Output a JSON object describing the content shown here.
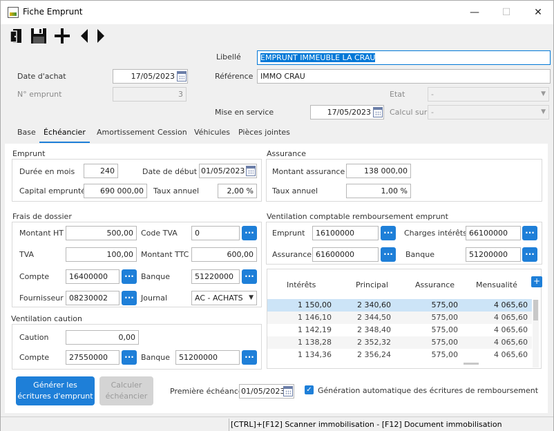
{
  "window": {
    "title": "Fiche Emprunt",
    "minimize": "—",
    "maximize": "☐",
    "close": "✕"
  },
  "toolbar": {
    "exit_icon": "exit-door-icon",
    "save_icon": "save-floppy-icon",
    "add_icon": "add-plus-icon",
    "prev_icon": "previous-arrow-icon",
    "next_icon": "next-arrow-icon"
  },
  "header": {
    "libelle_label": "Libellé",
    "libelle_value": "EMPRUNT IMMEUBLE LA CRAU",
    "date_achat_label": "Date d'achat",
    "date_achat_value": "17/05/2023",
    "reference_label": "Référence",
    "reference_value": "IMMO CRAU",
    "numero_label": "N° emprunt",
    "numero_value": "3",
    "etat_label": "Etat",
    "etat_value": "-",
    "mise_service_label": "Mise en service",
    "mise_service_value": "17/05/2023",
    "calcul_sur_label": "Calcul sur",
    "calcul_sur_value": "-"
  },
  "tabs": [
    "Base",
    "Échéancier",
    "Amortissement",
    "Cession",
    "Véhicules",
    "Pièces jointes"
  ],
  "emprunt": {
    "title": "Emprunt",
    "duree_label": "Durée en mois",
    "duree_value": "240",
    "date_debut_label": "Date de début",
    "date_debut_value": "01/05/2023",
    "capital_label": "Capital emprunté",
    "capital_value": "690 000,00",
    "taux_label": "Taux annuel",
    "taux_value": "2,00 %"
  },
  "assurance": {
    "title": "Assurance",
    "montant_label": "Montant assurance",
    "montant_value": "138 000,00",
    "taux_label": "Taux annuel",
    "taux_value": "1,00 %"
  },
  "frais": {
    "title": "Frais de dossier",
    "montant_ht_label": "Montant HT",
    "montant_ht_value": "500,00",
    "code_tva_label": "Code TVA",
    "code_tva_value": "0",
    "tva_label": "TVA",
    "tva_value": "100,00",
    "montant_ttc_label": "Montant TTC",
    "montant_ttc_value": "600,00",
    "compte_label": "Compte",
    "compte_value": "16400000",
    "banque_label": "Banque",
    "banque_value": "51220000",
    "fournisseur_label": "Fournisseur",
    "fournisseur_value": "08230002",
    "journal_label": "Journal",
    "journal_value": "AC - ACHATS"
  },
  "ventilation_remb": {
    "title": "Ventilation comptable remboursement emprunt",
    "emprunt_label": "Emprunt",
    "emprunt_value": "16100000",
    "charges_label": "Charges intérêts",
    "charges_value": "66100000",
    "assurance_label": "Assurance",
    "assurance_value": "61600000",
    "banque_label": "Banque",
    "banque_value": "51200000"
  },
  "caution": {
    "title": "Ventilation caution",
    "caution_label": "Caution",
    "caution_value": "0,00",
    "compte_label": "Compte",
    "compte_value": "27550000",
    "banque_label": "Banque",
    "banque_value": "51200000"
  },
  "echeancier": {
    "columns": [
      "Intérêts",
      "Principal",
      "Assurance",
      "Mensualité"
    ],
    "add_label": "+",
    "rows": [
      [
        "1 150,00",
        "2 340,60",
        "575,00",
        "4 065,60"
      ],
      [
        "1 146,10",
        "2 344,50",
        "575,00",
        "4 065,60"
      ],
      [
        "1 142,19",
        "2 348,40",
        "575,00",
        "4 065,60"
      ],
      [
        "1 138,28",
        "2 352,32",
        "575,00",
        "4 065,60"
      ],
      [
        "1 134,36",
        "2 356,24",
        "575,00",
        "4 065,60"
      ]
    ]
  },
  "actions": {
    "generer_label": "Générer les écritures d'emprunt",
    "calculer_label": "Calculer échéancier",
    "premiere_echeance_label": "Première échéance",
    "premiere_echeance_value": "01/05/2023",
    "auto_generation_label": "Génération automatique des écritures de remboursement",
    "auto_generation_checked": "✓"
  },
  "dots_label": "...",
  "status": {
    "text": "[CTRL]+[F12]  Scanner immobilisation - [F12]  Document immobilisation"
  },
  "colors": {
    "accent": "#1e7fd8",
    "selection": "#0078d7",
    "row_selected": "#cce4f7"
  }
}
